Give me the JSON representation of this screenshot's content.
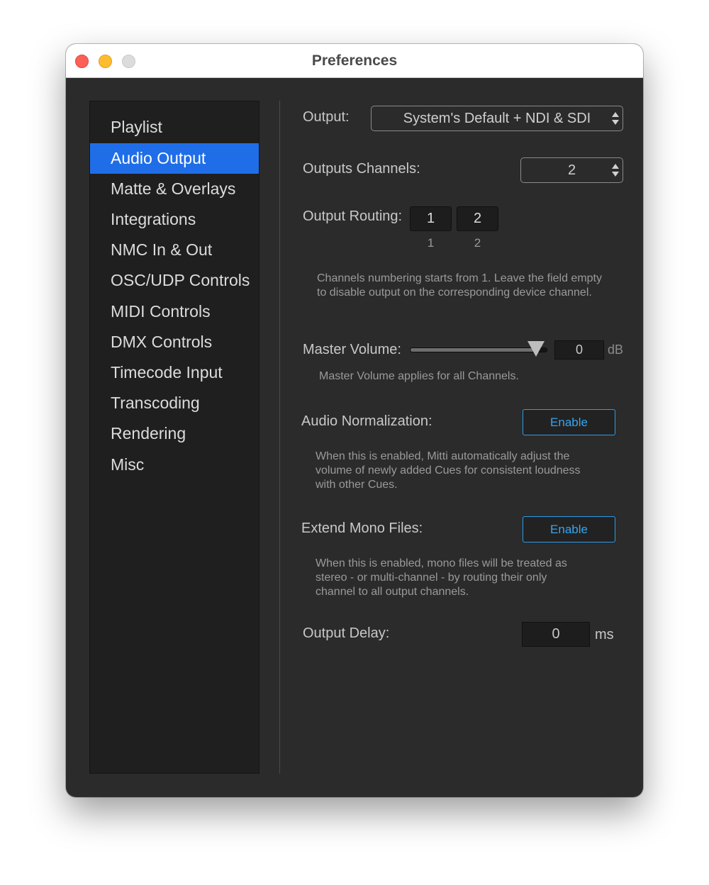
{
  "window": {
    "title": "Preferences"
  },
  "sidebar": {
    "items": [
      {
        "label": "Playlist"
      },
      {
        "label": "Audio Output",
        "selected": true
      },
      {
        "label": "Matte & Overlays"
      },
      {
        "label": "Integrations"
      },
      {
        "label": "NMC In & Out"
      },
      {
        "label": "OSC/UDP Controls"
      },
      {
        "label": "MIDI Controls"
      },
      {
        "label": "DMX Controls"
      },
      {
        "label": "Timecode Input"
      },
      {
        "label": "Transcoding"
      },
      {
        "label": "Rendering"
      },
      {
        "label": "Misc"
      }
    ]
  },
  "output": {
    "label": "Output:",
    "value": "System's Default + NDI & SDI"
  },
  "channels": {
    "label": "Outputs Channels:",
    "value": "2"
  },
  "routing": {
    "label": "Output Routing:",
    "slots": [
      {
        "value": "1",
        "channel": "1"
      },
      {
        "value": "2",
        "channel": "2"
      }
    ],
    "help": "Channels numbering starts from 1. Leave the field empty to disable output on the corresponding device channel."
  },
  "master_volume": {
    "label": "Master Volume:",
    "level": 0.93,
    "value": "0",
    "unit": "dB",
    "help": "Master Volume applies for all Channels."
  },
  "normalization": {
    "label": "Audio Normalization:",
    "button": "Enable",
    "help": "When this is enabled, Mitti automatically adjust the volume of newly added Cues for consistent loudness with other Cues."
  },
  "mono": {
    "label": "Extend Mono Files:",
    "button": "Enable",
    "help": "When this is enabled, mono files will be treated as stereo - or multi-channel - by routing their only channel to all output channels."
  },
  "delay": {
    "label": "Output Delay:",
    "value": "0",
    "unit": "ms"
  },
  "colors": {
    "selected": "#1f6ee8",
    "accent": "#36a5f0",
    "background": "#2b2b2b",
    "sidebar": "#1f1f1f"
  }
}
